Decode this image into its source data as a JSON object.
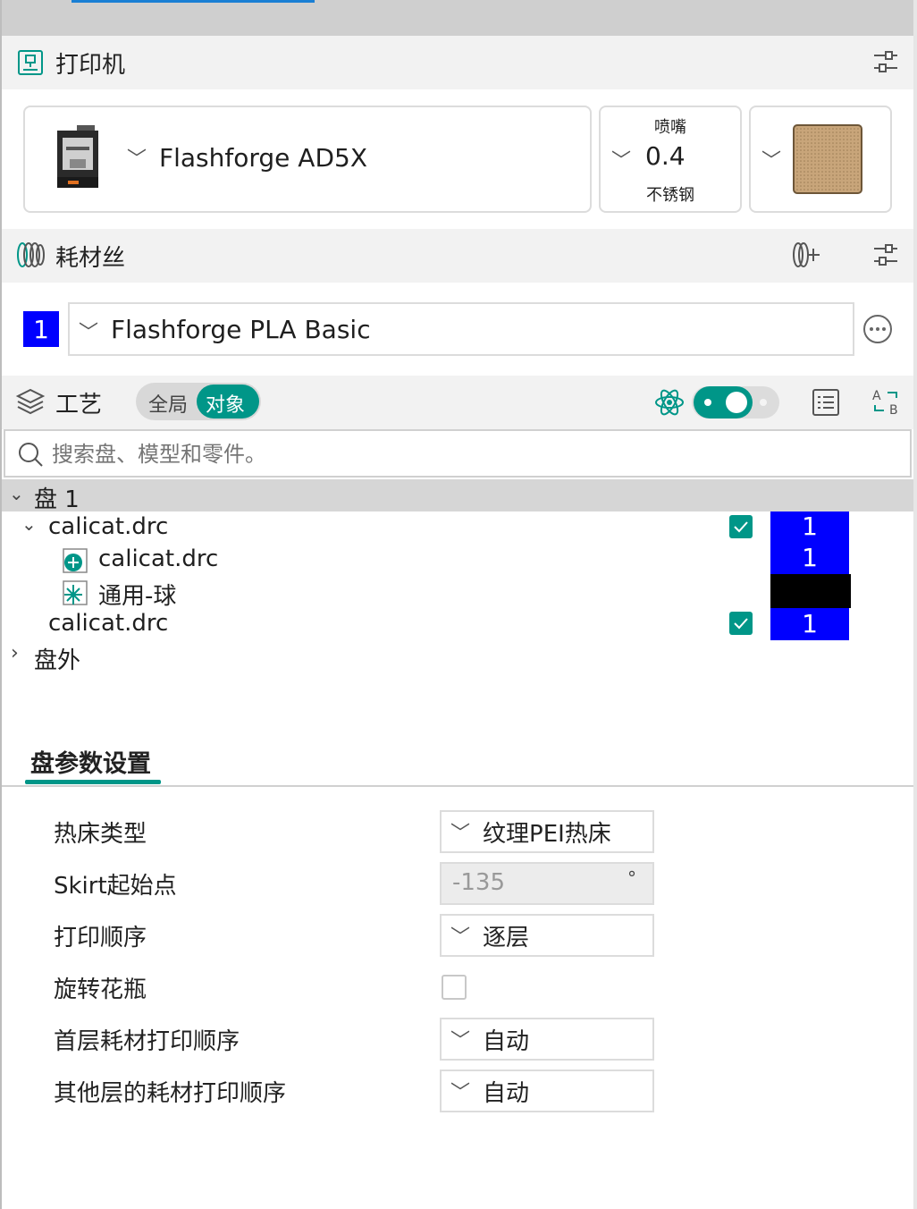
{
  "printer": {
    "section_title": "打印机",
    "name": "Flashforge AD5X",
    "nozzle_label": "喷嘴",
    "nozzle_size": "0.4",
    "nozzle_material": "不锈钢"
  },
  "filament": {
    "section_title": "耗材丝",
    "slot_number": "1",
    "name": "Flashforge PLA Basic",
    "slot_color": "#0000ff"
  },
  "process": {
    "section_title": "工艺",
    "toggle_global": "全局",
    "toggle_object": "对象",
    "accent_color": "#009688"
  },
  "search": {
    "placeholder": "搜索盘、模型和零件。"
  },
  "tree": {
    "plate_label": "盘 1",
    "object_name": "calicat.drc",
    "part_name": "calicat.drc",
    "modifier_name": "通用-球",
    "object2_name": "calicat.drc",
    "outside_label": "盘外",
    "extruder_values": [
      "1",
      "1",
      "1"
    ]
  },
  "plate_settings": {
    "tab_label": "盘参数设置",
    "params": [
      {
        "label": "热床类型",
        "value": "纹理PEI热床"
      },
      {
        "label": "Skirt起始点",
        "value": "-135",
        "unit": "°"
      },
      {
        "label": "打印顺序",
        "value": "逐层"
      },
      {
        "label": "旋转花瓶",
        "value": ""
      },
      {
        "label": "首层耗材打印顺序",
        "value": "自动"
      },
      {
        "label": "其他层的耗材打印顺序",
        "value": "自动"
      }
    ]
  },
  "icons": {
    "printer": "printer-icon",
    "settings": "sliders-icon",
    "filament": "filament-spool-icon",
    "add_filament": "add-filament-icon",
    "more": "more-dots-icon",
    "layers": "layers-icon",
    "atom": "atom-icon",
    "list": "list-icon",
    "swap": "swap-ab-icon",
    "search": "search-icon"
  }
}
